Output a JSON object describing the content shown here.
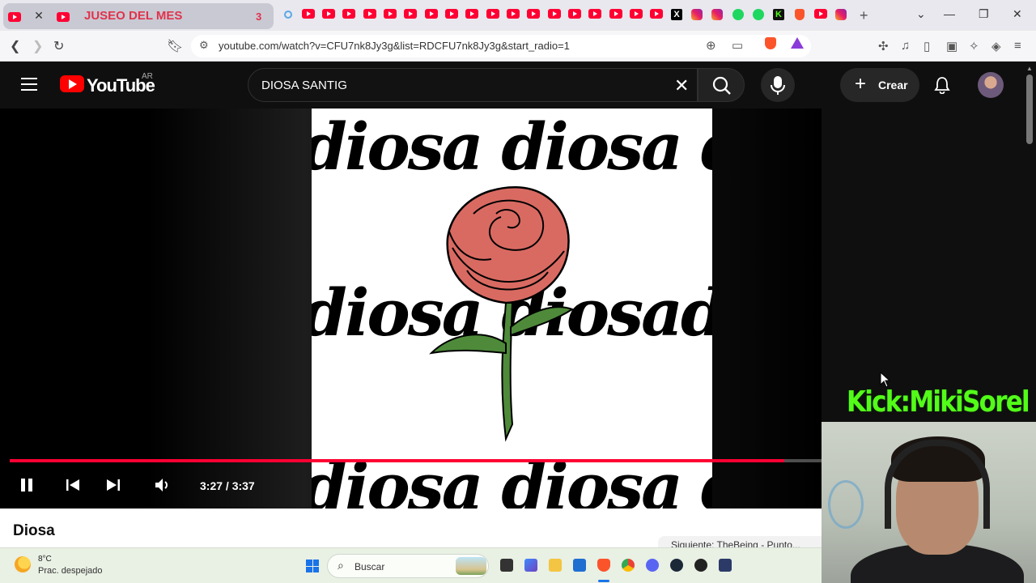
{
  "browser": {
    "active_tab_title": "JUSEO DEL MES",
    "active_tab_count": "3",
    "url": "youtube.com/watch?v=CFU7nk8Jy3g&list=RDCFU7nk8Jy3g&start_radio=1"
  },
  "youtube": {
    "logo_text": "YouTube",
    "country_code": "AR",
    "search_value": "DIOSA SANTIG",
    "create_label": "Crear"
  },
  "player": {
    "artwork_word": "diosa",
    "artwork_rows": [
      "diosa diosa diosa",
      "diosa diosadiosa",
      "diosa diosa diosa"
    ],
    "time_display": "3:27 / 3:37",
    "progress_fraction": 0.954,
    "state": "playing"
  },
  "video": {
    "title": "Diosa",
    "up_next_text": "Siguiente: TheBeing - Punto..."
  },
  "overlay": {
    "kick_text": "Kick:MikiSorel"
  },
  "taskbar": {
    "temperature": "8°C",
    "weather": "Prac. despejado",
    "search_placeholder": "Buscar"
  },
  "colors": {
    "yt_red": "#ff0033",
    "kick_green": "#53fc18",
    "rose_red": "#d96a62",
    "stem_green": "#4e8a3a"
  }
}
